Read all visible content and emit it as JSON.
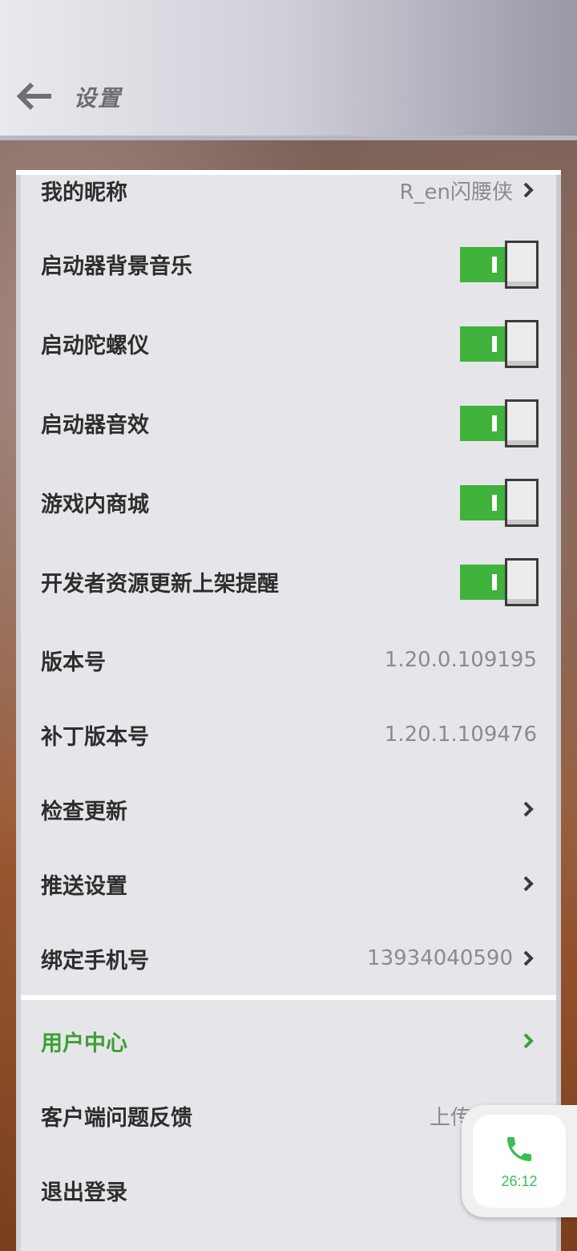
{
  "header": {
    "title": "设置"
  },
  "settings": {
    "nickname": {
      "label": "我的昵称",
      "value": "R_en闪腰侠"
    },
    "toggles": [
      {
        "label": "启动器背景音乐",
        "on": true
      },
      {
        "label": "启动陀螺仪",
        "on": true
      },
      {
        "label": "启动器音效",
        "on": true
      },
      {
        "label": "游戏内商城",
        "on": true
      },
      {
        "label": "开发者资源更新上架提醒",
        "on": true
      }
    ],
    "version": {
      "label": "版本号",
      "value": "1.20.0.109195"
    },
    "patch_version": {
      "label": "补丁版本号",
      "value": "1.20.1.109476"
    },
    "check_update": {
      "label": "检查更新"
    },
    "push_settings": {
      "label": "推送设置"
    },
    "bind_phone": {
      "label": "绑定手机号",
      "value": "13934040590"
    }
  },
  "account": {
    "user_center": {
      "label": "用户中心"
    },
    "feedback": {
      "label": "客户端问题反馈",
      "value": "上传日志"
    },
    "logout": {
      "label": "退出登录"
    }
  },
  "call_widget": {
    "time": "26:12",
    "icon": "phone-icon"
  },
  "colors": {
    "accent_green": "#3fb33b",
    "call_green": "#3bbf55"
  }
}
